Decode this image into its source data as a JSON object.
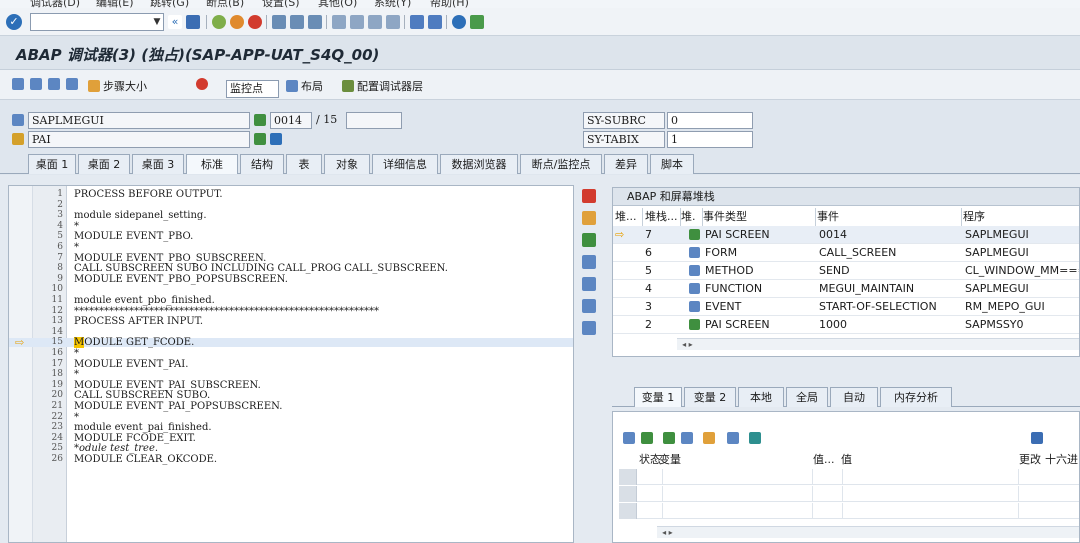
{
  "menubar": {
    "items": [
      "调试器(D)",
      "编辑(E)",
      "跳转(G)",
      "断点(B)",
      "设置(S)",
      "其他(O)",
      "系统(Y)",
      "帮助(H)"
    ]
  },
  "window": {
    "title": "ABAP 调试器(3) (独占)(SAP-APP-UAT_S4Q_00)"
  },
  "toolbar": {
    "step_size": "步骤大小",
    "watchpoint": "监控点",
    "layout": "布局",
    "configure_layer": "配置调试器层"
  },
  "info": {
    "program": "SAPLMEGUI",
    "pai": "PAI",
    "screen_no": "0014",
    "screen_of": "/ 15",
    "sy_subrc_label": "SY-SUBRC",
    "sy_subrc_value": "0",
    "sy_tabix_label": "SY-TABIX",
    "sy_tabix_value": "1"
  },
  "tabs": [
    "桌面 1",
    "桌面 2",
    "桌面 3",
    "标准",
    "结构",
    "表",
    "对象",
    "详细信息",
    "数据浏览器",
    "断点/监控点",
    "差异",
    "脚本"
  ],
  "active_tab": "标准",
  "source": {
    "lines": [
      {
        "n": "1",
        "t": "PROCESS BEFORE OUTPUT.",
        "k": "kw"
      },
      {
        "n": "2",
        "t": "",
        "k": ""
      },
      {
        "n": "3",
        "t": "module sidepanel_setting.",
        "k": ""
      },
      {
        "n": "4",
        "t": "*",
        "k": "cm"
      },
      {
        "n": "5",
        "t": "MODULE EVENT_PBO.",
        "k": ""
      },
      {
        "n": "6",
        "t": "*",
        "k": "cm"
      },
      {
        "n": "7",
        "t": "MODULE EVENT_PBO_SUBSCREEN.",
        "k": ""
      },
      {
        "n": "8",
        "t": "CALL SUBSCREEN SUBO INCLUDING CALL_PROG CALL_SUBSCREEN.",
        "k": ""
      },
      {
        "n": "9",
        "t": "MODULE EVENT_PBO_POPSUBSCREEN.",
        "k": ""
      },
      {
        "n": "10",
        "t": "",
        "k": ""
      },
      {
        "n": "11",
        "t": "module event_pbo_finished.",
        "k": ""
      },
      {
        "n": "12",
        "t": "*************************************************************",
        "k": "cm"
      },
      {
        "n": "13",
        "t": "PROCESS AFTER INPUT.",
        "k": "kw"
      },
      {
        "n": "14",
        "t": "",
        "k": ""
      },
      {
        "n": "15",
        "t": "MODULE GET_FCODE.",
        "k": ""
      },
      {
        "n": "16",
        "t": "*",
        "k": "cm"
      },
      {
        "n": "17",
        "t": "MODULE EVENT_PAI.",
        "k": ""
      },
      {
        "n": "18",
        "t": "*",
        "k": "cm"
      },
      {
        "n": "19",
        "t": "MODULE EVENT_PAI_SUBSCREEN.",
        "k": ""
      },
      {
        "n": "20",
        "t": "CALL SUBSCREEN SUBO.",
        "k": ""
      },
      {
        "n": "21",
        "t": "MODULE EVENT_PAI_POPSUBSCREEN.",
        "k": ""
      },
      {
        "n": "22",
        "t": "*",
        "k": "cm"
      },
      {
        "n": "23",
        "t": "module event_pai_finished.",
        "k": ""
      },
      {
        "n": "24",
        "t": "MODULE FCODE_EXIT.",
        "k": ""
      },
      {
        "n": "25",
        "t": "*odule test_tree.",
        "k": "cm"
      },
      {
        "n": "26",
        "t": "MODULE CLEAR_OKCODE.",
        "k": ""
      }
    ],
    "current_line": "15"
  },
  "stack": {
    "title": "ABAP 和屏幕堆栈",
    "headers": [
      "堆...",
      "堆栈...",
      "堆.",
      "事件类型",
      "事件",
      "程序"
    ],
    "rows": [
      {
        "level": "7",
        "type": "PAI SCREEN",
        "event": "0014",
        "program": "SAPLMEGUI",
        "current": true
      },
      {
        "level": "6",
        "type": "FORM",
        "event": "CALL_SCREEN",
        "program": "SAPLMEGUI",
        "current": false
      },
      {
        "level": "5",
        "type": "METHOD",
        "event": "SEND",
        "program": "CL_WINDOW_MM=====",
        "current": false
      },
      {
        "level": "4",
        "type": "FUNCTION",
        "event": "MEGUI_MAINTAIN",
        "program": "SAPLMEGUI",
        "current": false
      },
      {
        "level": "3",
        "type": "EVENT",
        "event": "START-OF-SELECTION",
        "program": "RM_MEPO_GUI",
        "current": false
      },
      {
        "level": "2",
        "type": "PAI SCREEN",
        "event": "1000",
        "program": "SAPMSSY0",
        "current": false
      }
    ]
  },
  "vartabs": [
    "变量 1",
    "变量 2",
    "本地",
    "全局",
    "自动",
    "内存分析"
  ],
  "active_vartab": "变量 1",
  "vars": {
    "headers": [
      "状态",
      "变量",
      "值...",
      "值",
      "更改",
      "十六进"
    ]
  },
  "colors": {
    "accent": "#2d6fb8",
    "arrow": "#e8a000",
    "keyword": "#1f3fb0"
  }
}
